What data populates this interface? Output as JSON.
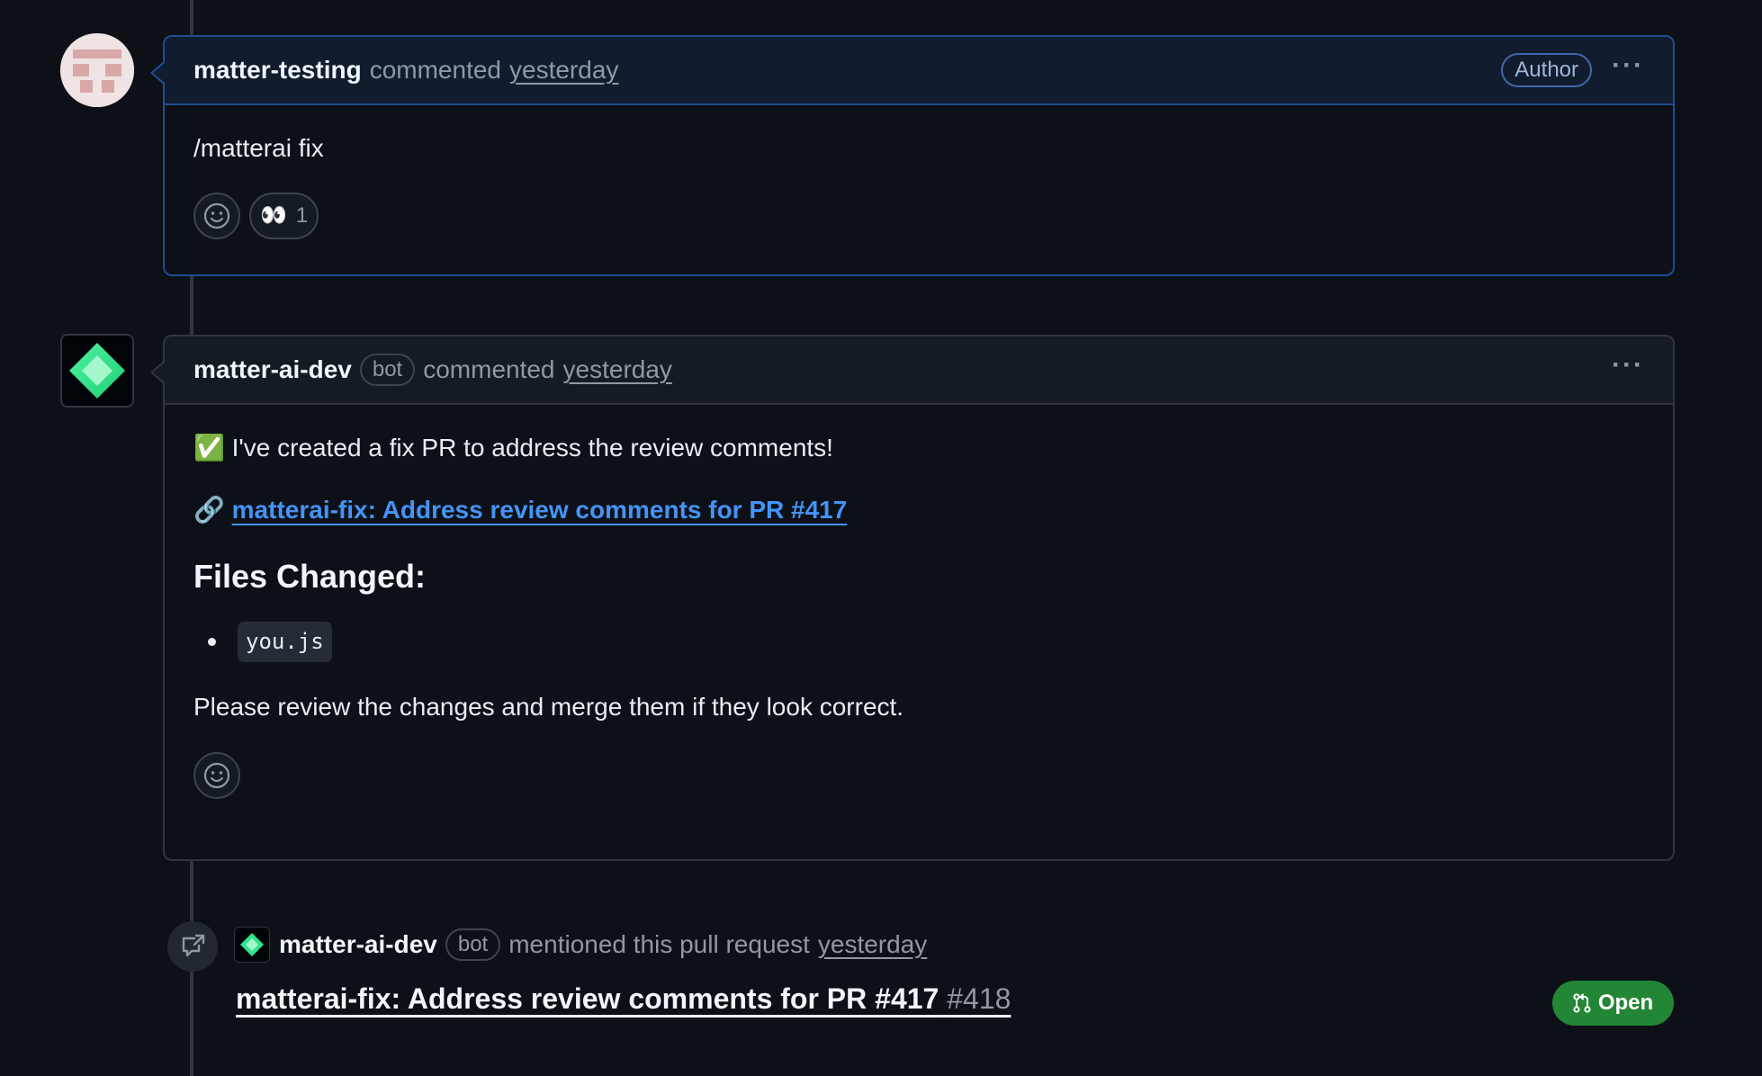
{
  "comment1": {
    "author": "matter-testing",
    "action": "commented",
    "time": "yesterday",
    "badge": "Author",
    "body": "/matterai fix",
    "reaction": {
      "emoji": "👀",
      "count": "1"
    }
  },
  "comment2": {
    "author": "matter-ai-dev",
    "bot_label": "bot",
    "action": "commented",
    "time": "yesterday",
    "line1_emoji": "✅",
    "line1": "I've created a fix PR to address the review comments!",
    "link_emoji": "🔗",
    "link_text": "matterai-fix: Address review comments for PR #417",
    "files_heading": "Files Changed:",
    "files": [
      "you.js"
    ],
    "closing": "Please review the changes and merge them if they look correct."
  },
  "mention": {
    "author": "matter-ai-dev",
    "bot_label": "bot",
    "text": "mentioned this pull request",
    "time": "yesterday",
    "pr_title": "matterai-fix: Address review comments for PR #417",
    "pr_number": "#418",
    "status": "Open"
  },
  "colors": {
    "background": "#0d1117",
    "accent_blue": "#4493f8",
    "open_green": "#238636"
  }
}
